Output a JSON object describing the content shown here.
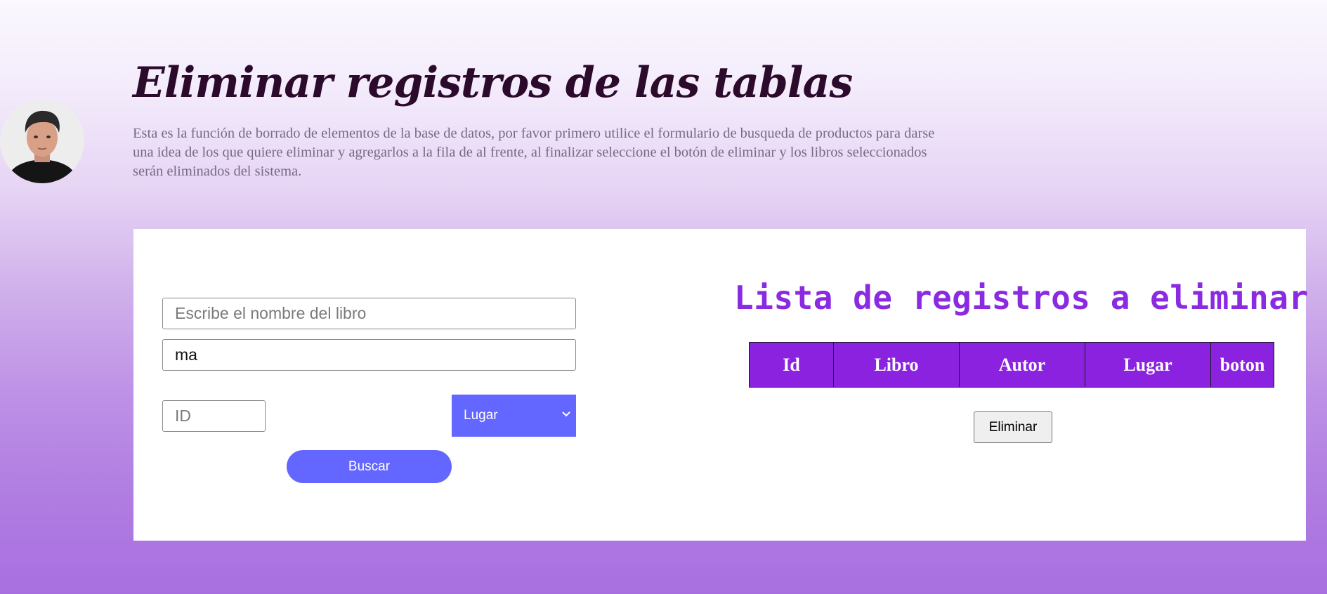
{
  "header": {
    "title": "Eliminar registros de las tablas",
    "description": "Esta es la función de borrado de elementos de la base de datos, por favor primero utilice el formulario de busqueda de productos para darse una idea de los que quiere eliminar y agregarlos a la fila de al frente, al finalizar seleccione el botón de eliminar y los libros seleccionados serán eliminados del sistema."
  },
  "search_form": {
    "book_name_placeholder": "Escribe el nombre del libro",
    "author_value": "ma",
    "id_placeholder": "ID",
    "place_select_value": "Lugar",
    "search_button": "Buscar"
  },
  "records": {
    "title": "Lista de registros a eliminar",
    "columns": [
      "Id",
      "Libro",
      "Autor",
      "Lugar",
      "boton"
    ],
    "rows": [],
    "delete_button": "Eliminar"
  },
  "colors": {
    "accent": "#6366ff",
    "table_header": "#8a22e0",
    "list_title": "#8a2be2",
    "page_title": "#2c0a2c"
  }
}
